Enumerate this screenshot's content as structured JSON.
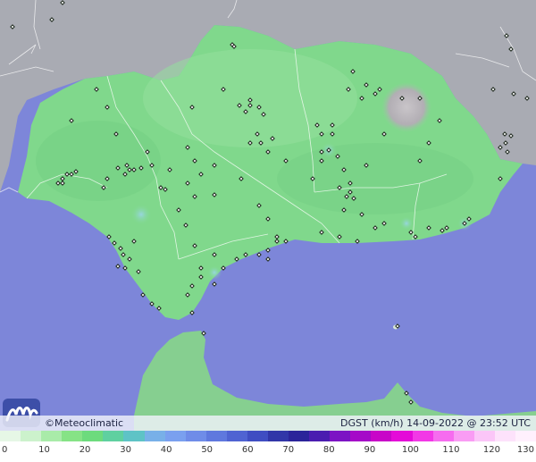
{
  "map": {
    "colors": {
      "sea": "#7d86d9",
      "land_outside": "#a9abb3",
      "region": "#80d88c",
      "region_light": "#98e3a2",
      "calm_spots": "#8fb3e6",
      "mountain": "#b6b2b6",
      "station": "#1f2a1f",
      "border": "#ffffff"
    },
    "station_icon": "station-dot-icon"
  },
  "caption": {
    "brand": "©Meteoclimatic",
    "product": "DGST (km/h)  14-09-2022 @ 23:52 UTC",
    "logo_icon": "meteoclimatic-logo-icon"
  },
  "legend": {
    "labels": [
      "0",
      "10",
      "20",
      "30",
      "40",
      "50",
      "60",
      "70",
      "80",
      "90",
      "100",
      "110",
      "120",
      "130"
    ],
    "colors": [
      "#e6f7e6",
      "#ccf2cc",
      "#a9eba9",
      "#86e386",
      "#6ddb7d",
      "#5fd0a0",
      "#5ec3c6",
      "#78b0e8",
      "#7aa0ef",
      "#6f8ce8",
      "#5f78de",
      "#4f63d2",
      "#3f4dc2",
      "#3136a8",
      "#2b249a",
      "#4a1db0",
      "#7c14c4",
      "#a50ac8",
      "#c806c8",
      "#e40ad8",
      "#f238e6",
      "#f66cef",
      "#f99cf4",
      "#fbc6f8",
      "#fde2fb",
      "#fff0fd"
    ]
  }
}
